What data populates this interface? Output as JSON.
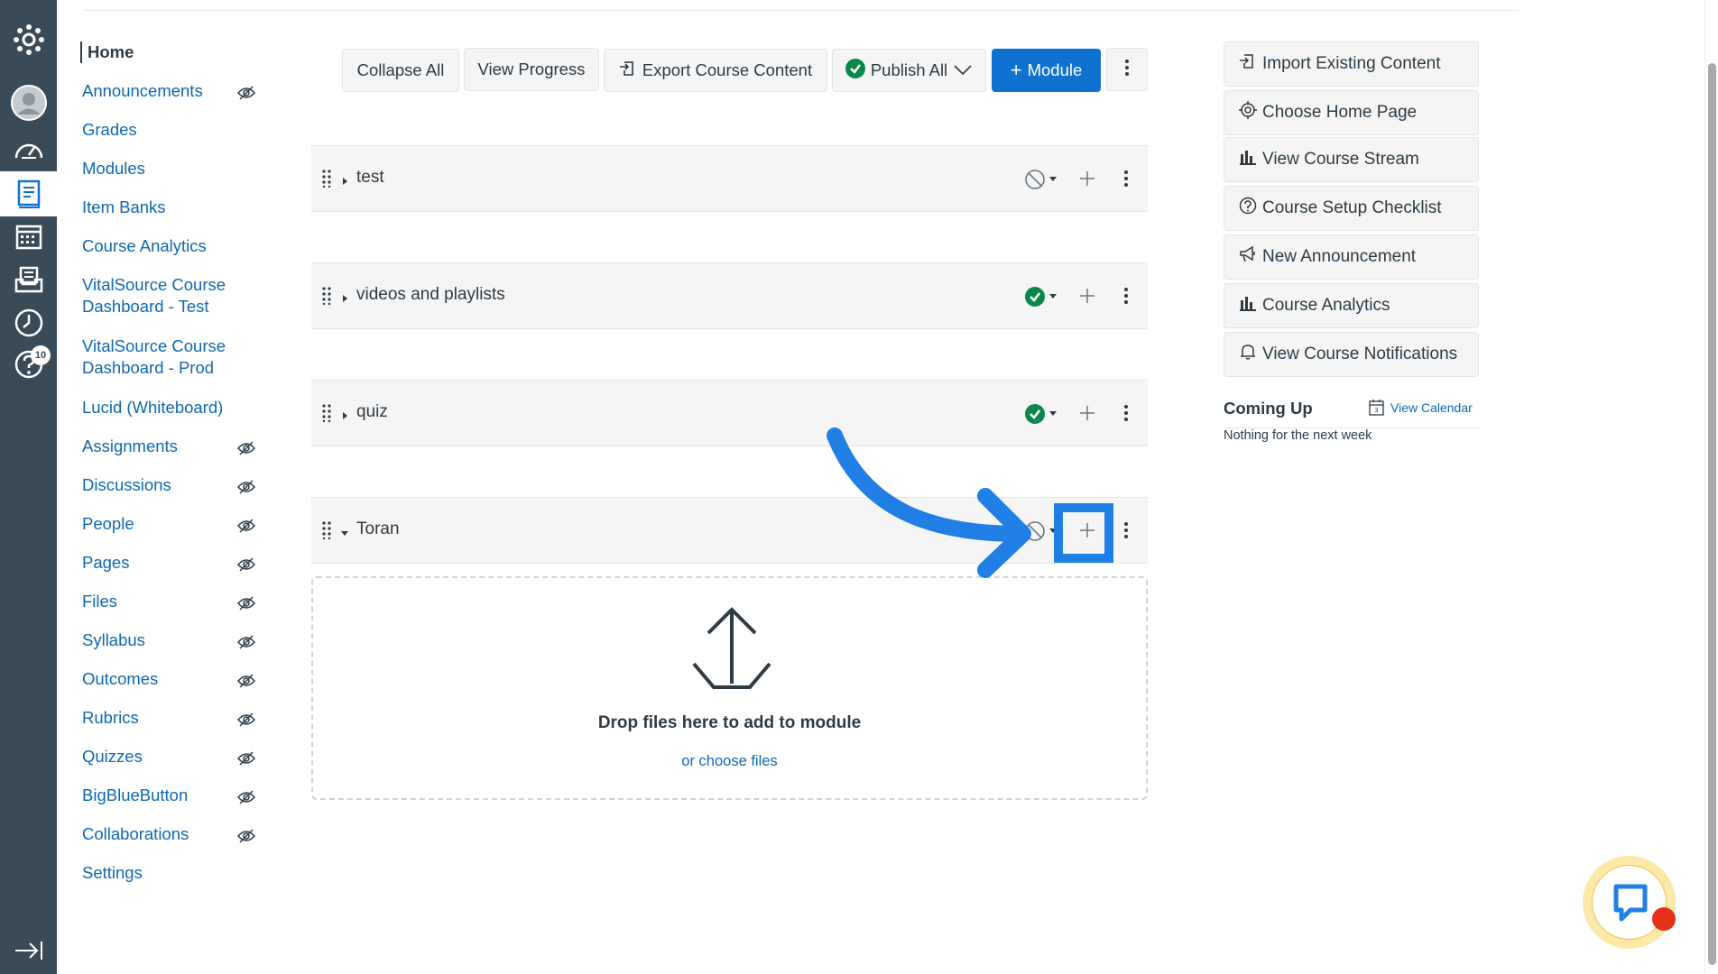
{
  "global_nav": {
    "icons": [
      "canvas-logo-icon",
      "account-icon",
      "dashboard-icon",
      "courses-icon",
      "calendar-icon",
      "inbox-icon",
      "history-icon",
      "help-icon",
      "collapse-nav-icon"
    ],
    "help_badge": "10",
    "background": "#394b58"
  },
  "course_nav": {
    "items": [
      {
        "label": "Home",
        "hidden": false
      },
      {
        "label": "Announcements",
        "hidden": true
      },
      {
        "label": "Grades",
        "hidden": false
      },
      {
        "label": "Modules",
        "hidden": false
      },
      {
        "label": "Item Banks",
        "hidden": false
      },
      {
        "label": "Course Analytics",
        "hidden": false
      },
      {
        "label": "VitalSource Course Dashboard - Test",
        "hidden": false
      },
      {
        "label": "VitalSource Course Dashboard - Prod",
        "hidden": false
      },
      {
        "label": "Lucid (Whiteboard)",
        "hidden": false
      },
      {
        "label": "Assignments",
        "hidden": true
      },
      {
        "label": "Discussions",
        "hidden": true
      },
      {
        "label": "People",
        "hidden": true
      },
      {
        "label": "Pages",
        "hidden": true
      },
      {
        "label": "Files",
        "hidden": true
      },
      {
        "label": "Syllabus",
        "hidden": true
      },
      {
        "label": "Outcomes",
        "hidden": true
      },
      {
        "label": "Rubrics",
        "hidden": true
      },
      {
        "label": "Quizzes",
        "hidden": true
      },
      {
        "label": "BigBlueButton",
        "hidden": true
      },
      {
        "label": "Collaborations",
        "hidden": true
      },
      {
        "label": "Settings",
        "hidden": false
      }
    ]
  },
  "toolbar": {
    "collapse_all": "Collapse All",
    "view_progress": "View Progress",
    "export": "Export Course Content",
    "publish_all": "Publish All",
    "add_module": "Module",
    "add_symbol": "+"
  },
  "modules": [
    {
      "name": "test",
      "published": false,
      "expanded": false
    },
    {
      "name": "videos and playlists",
      "published": true,
      "expanded": false
    },
    {
      "name": "quiz",
      "published": true,
      "expanded": false
    },
    {
      "name": "Toran",
      "published": false,
      "expanded": true
    }
  ],
  "dropzone": {
    "text": "Drop files here to add to module",
    "link": "or choose files"
  },
  "sidebar": {
    "buttons": [
      {
        "label": "Import Existing Content",
        "icon": "import-icon"
      },
      {
        "label": "Choose Home Page",
        "icon": "target-icon"
      },
      {
        "label": "View Course Stream",
        "icon": "bar-chart-icon"
      },
      {
        "label": "Course Setup Checklist",
        "icon": "question-icon"
      },
      {
        "label": "New Announcement",
        "icon": "megaphone-icon"
      },
      {
        "label": "Course Analytics",
        "icon": "bar-chart-icon"
      },
      {
        "label": "View Course Notifications",
        "icon": "bell-icon"
      }
    ],
    "coming_up": "Coming Up",
    "view_calendar": "View Calendar",
    "nothing": "Nothing for the next week"
  },
  "colors": {
    "accent": "#0e72d0",
    "published_green": "#0b874b",
    "annotation_blue": "#1f7fe5",
    "link": "#0e68b3"
  }
}
